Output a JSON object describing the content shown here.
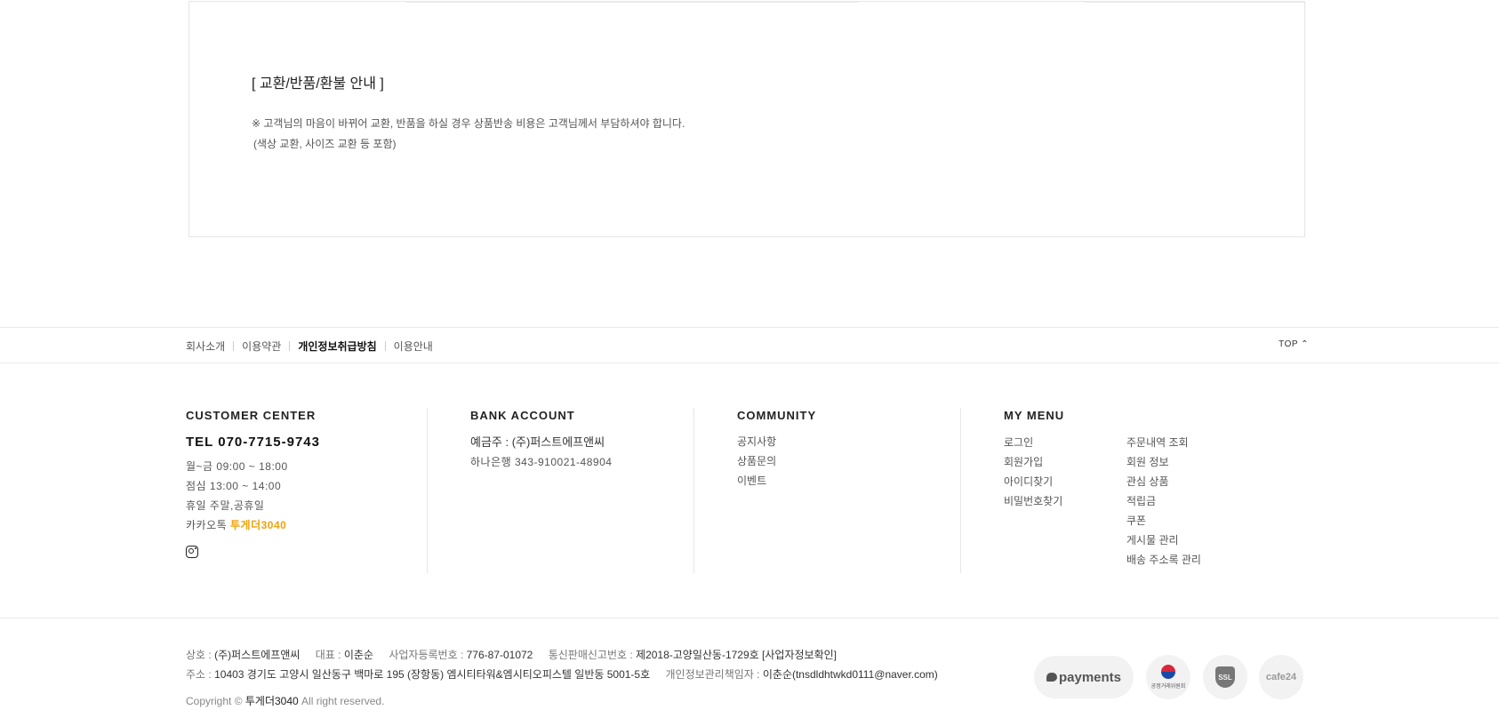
{
  "notice": {
    "title": "[ 교환/반품/환불 안내 ]",
    "line1": "※ 고객님의 마음이 바뀌어 교환, 반품을 하실 경우 상품반송 비용은 고객님께서 부담하셔야 합니다.",
    "line2": "(색상 교환, 사이즈 교환 등 포함)"
  },
  "footer_nav": {
    "links": [
      "회사소개",
      "이용약관",
      "개인정보취급방침",
      "이용안내"
    ],
    "top_label": "TOP ⌃"
  },
  "customer_center": {
    "heading": "CUSTOMER CENTER",
    "tel": "TEL 070-7715-9743",
    "hours": "월~금 09:00 ~ 18:00",
    "lunch": "점심 13:00 ~ 14:00",
    "holiday": "휴일 주말,공휴일",
    "kakao_prefix": "카카오톡 ",
    "kakao_id": "투게더3040",
    "social_icon": "instagram-icon"
  },
  "bank_account": {
    "heading": "BANK ACCOUNT",
    "holder": "예금주 : (주)퍼스트에프앤씨",
    "account": "하나은행 343-910021-48904"
  },
  "community": {
    "heading": "COMMUNITY",
    "items": [
      "공지사항",
      "상품문의",
      "이벤트"
    ]
  },
  "my_menu": {
    "heading": "MY MENU",
    "col1": [
      "로그인",
      "회원가입",
      "아이디찾기",
      "비밀번호찾기"
    ],
    "col2": [
      "주문내역 조회",
      "회원 정보",
      "관심 상품",
      "적립금",
      "쿠폰",
      "게시물 관리",
      "배송 주소록 관리"
    ]
  },
  "business": {
    "company_label": "상호 : ",
    "company": "(주)퍼스트에프앤씨",
    "ceo_label": "대표 : ",
    "ceo": "이춘순",
    "regno_label": "사업자등록번호 : ",
    "regno": "776-87-01072",
    "mailorder_label": "통신판매신고번호 : ",
    "mailorder": "제2018-고양일산동-1729호",
    "confirm_link": "[사업자정보확인]",
    "address_label": "주소 : ",
    "address": "10403 경기도 고양시 일산동구 백마로 195 (장항동) 엠시티타워&엠시티오피스텔 일반동 5001-5호",
    "privacy_label": "개인정보관리책임자 : ",
    "privacy": "이춘순(tnsdldhtwkd0111@naver.com)"
  },
  "copyright": {
    "prefix": "Copyright © ",
    "brand": "투게더3040",
    "suffix": " All right reserved."
  },
  "badges": {
    "payments": "payments",
    "ftc": "공정거래위원회",
    "ssl": "SSL",
    "cafe24": "cafe24"
  }
}
